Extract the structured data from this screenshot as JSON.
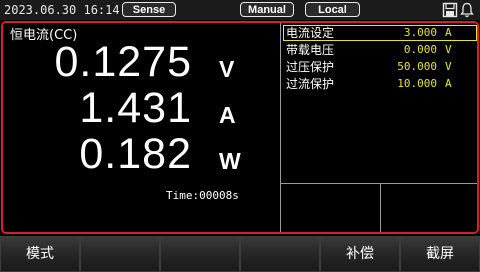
{
  "status_bar": {
    "datetime": "2023.06.30 16:14",
    "sense_label": "Sense",
    "control_mode_label": "Manual",
    "remote_state_label": "Local",
    "icons": [
      "save-icon",
      "bell-icon"
    ]
  },
  "measurement": {
    "mode_label": "恒电流(CC)",
    "voltage": {
      "value": "0.1275",
      "unit": "V"
    },
    "current": {
      "value": "1.431",
      "unit": "A"
    },
    "power": {
      "value": "0.182",
      "unit": "W"
    },
    "time": "Time:00008s"
  },
  "parameters": [
    {
      "label": "电流设定",
      "value": "3.000",
      "unit": "A",
      "selected": true
    },
    {
      "label": "带载电压",
      "value": "0.000",
      "unit": "V",
      "selected": false
    },
    {
      "label": "过压保护",
      "value": "50.000",
      "unit": "V",
      "selected": false
    },
    {
      "label": "过流保护",
      "value": "10.000",
      "unit": "A",
      "selected": false
    }
  ],
  "softkeys": [
    "模式",
    "",
    "",
    "",
    "补偿",
    "截屏"
  ],
  "colors": {
    "frame": "#d4202a",
    "value_highlight": "#e8e23a",
    "background": "#000000"
  }
}
